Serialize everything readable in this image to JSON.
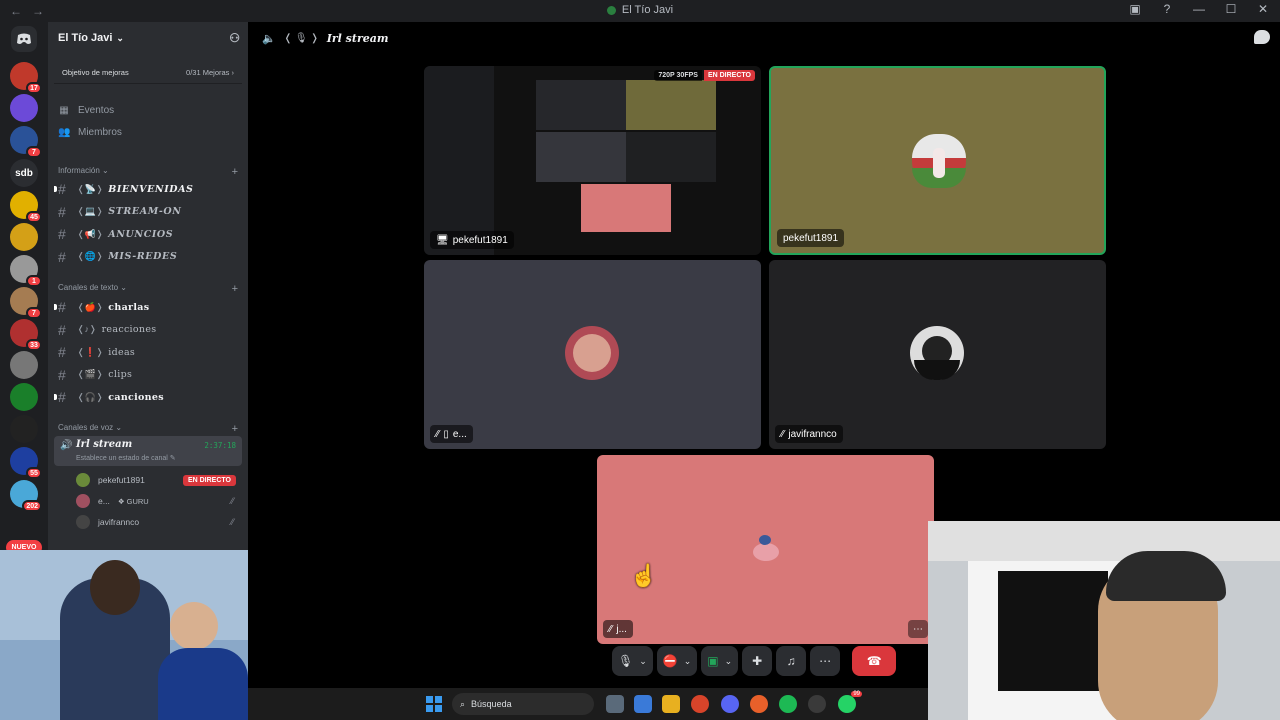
{
  "window": {
    "title": "El Tío Javi",
    "back": "←",
    "forward": "→"
  },
  "rail": {
    "servers": [
      {
        "name": "server-1",
        "badge": "17",
        "color": "#c0392b"
      },
      {
        "name": "server-2",
        "badge": "",
        "color": "#6c4ad8"
      },
      {
        "name": "server-3",
        "badge": "7",
        "color": "#2a5298"
      },
      {
        "name": "sdb",
        "badge": "",
        "color": "#2b2d31"
      },
      {
        "name": "server-5",
        "badge": "45",
        "color": "#e1b000"
      },
      {
        "name": "server-6",
        "badge": "",
        "color": "#d4a017"
      },
      {
        "name": "server-7",
        "badge": "1",
        "color": "#999"
      },
      {
        "name": "server-8",
        "badge": "7",
        "color": "#a57c52"
      },
      {
        "name": "server-9",
        "badge": "33",
        "color": "#b03030"
      },
      {
        "name": "server-10",
        "badge": "",
        "color": "#777"
      },
      {
        "name": "server-11",
        "badge": "",
        "color": "#1a7f2a"
      },
      {
        "name": "server-12",
        "badge": "",
        "color": "#222"
      },
      {
        "name": "server-13",
        "badge": "55",
        "color": "#1e3fa0"
      },
      {
        "name": "server-14",
        "badge": "202",
        "color": "#4aa8d8"
      }
    ],
    "sdb_label": "sdb",
    "new_label": "NUEVO"
  },
  "sidebar": {
    "guild_name": "El Tío Javi",
    "goal_label": "Objetivo de mejoras",
    "goal_value": "0/31 Mejoras",
    "events": "Eventos",
    "members": "Miembros",
    "cat_info": "Información",
    "info_channels": [
      {
        "emoji": "📡",
        "name": "BIENVENIDAS",
        "bold": true
      },
      {
        "emoji": "💻",
        "name": "STREAM-ON",
        "bold": false
      },
      {
        "emoji": "📢",
        "name": "ANUNCIOS",
        "bold": false
      },
      {
        "emoji": "🌐",
        "name": "MIS-REDES",
        "bold": false
      }
    ],
    "cat_text": "Canales de texto",
    "text_channels": [
      {
        "emoji": "🍎",
        "name": "charlas",
        "bold": true
      },
      {
        "emoji": "♪",
        "name": "reacciones",
        "bold": false
      },
      {
        "emoji": "❗",
        "name": "ideas",
        "bold": false
      },
      {
        "emoji": "🎬",
        "name": "clips",
        "bold": false
      },
      {
        "emoji": "🎧",
        "name": "canciones",
        "bold": true
      }
    ],
    "cat_voice": "Canales de voz",
    "voice": {
      "name": "Irl stream",
      "time": "2:37:18",
      "status": "Establece un estado de canal",
      "users": [
        {
          "name": "pekefut1891",
          "live": "EN DIRECTO",
          "color": "#6a8a3a"
        },
        {
          "name": "e...",
          "extra": "GURU",
          "color": "#a05060"
        },
        {
          "name": "javifrannco",
          "color": "#444"
        }
      ]
    }
  },
  "header": {
    "title": "Irl stream"
  },
  "tiles": {
    "stream": {
      "user": "pekefut1891",
      "quality": "720P 30FPS",
      "live": "EN DIRECTO"
    },
    "cam": {
      "user": "pekefut1891",
      "bg": "#7a7140"
    },
    "e_user": {
      "user": "e...",
      "bg": "#3a3b45"
    },
    "javi": {
      "user": "javifrannco",
      "bg": "#222224"
    },
    "pink": {
      "user": "j...",
      "bg": "#d87878"
    }
  },
  "taskbar": {
    "search": "Búsqueda",
    "badge": "99"
  }
}
